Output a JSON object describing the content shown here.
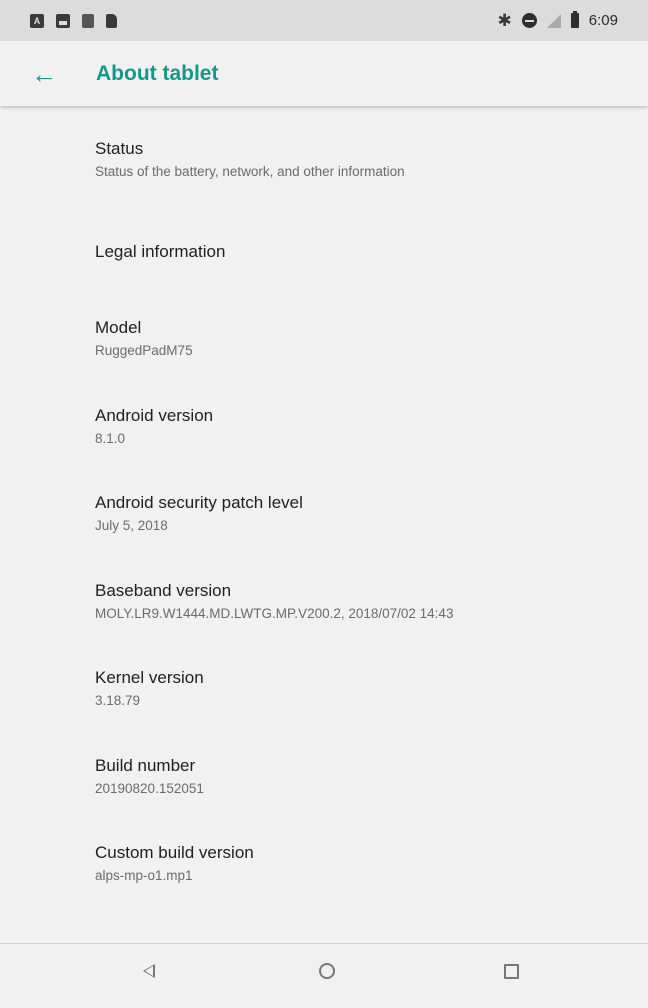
{
  "status_bar": {
    "left_icons": [
      "a-icon",
      "photo-icon",
      "storage-icon",
      "sd-card-icon"
    ],
    "right_icons": [
      "bluetooth-icon",
      "do-not-disturb-icon",
      "no-signal-icon",
      "battery-icon"
    ],
    "time": "6:09",
    "letter": "A"
  },
  "app_bar": {
    "back_icon": "←",
    "title": "About tablet",
    "accent_color": "#17978a"
  },
  "items": [
    {
      "title": "Status",
      "subtitle": "Status of the battery, network, and other information"
    },
    {
      "title": "Legal information",
      "subtitle": ""
    },
    {
      "title": "Model",
      "subtitle": "RuggedPadM75"
    },
    {
      "title": "Android version",
      "subtitle": "8.1.0"
    },
    {
      "title": "Android security patch level",
      "subtitle": "July 5, 2018"
    },
    {
      "title": "Baseband version",
      "subtitle": "MOLY.LR9.W1444.MD.LWTG.MP.V200.2, 2018/07/02 14:43"
    },
    {
      "title": "Kernel version",
      "subtitle": "3.18.79"
    },
    {
      "title": "Build number",
      "subtitle": "20190820.152051"
    },
    {
      "title": "Custom build version",
      "subtitle": "alps-mp-o1.mp1"
    }
  ],
  "nav_bar": {
    "icons": [
      "back-triangle-icon",
      "home-circle-icon",
      "recents-square-icon"
    ]
  }
}
